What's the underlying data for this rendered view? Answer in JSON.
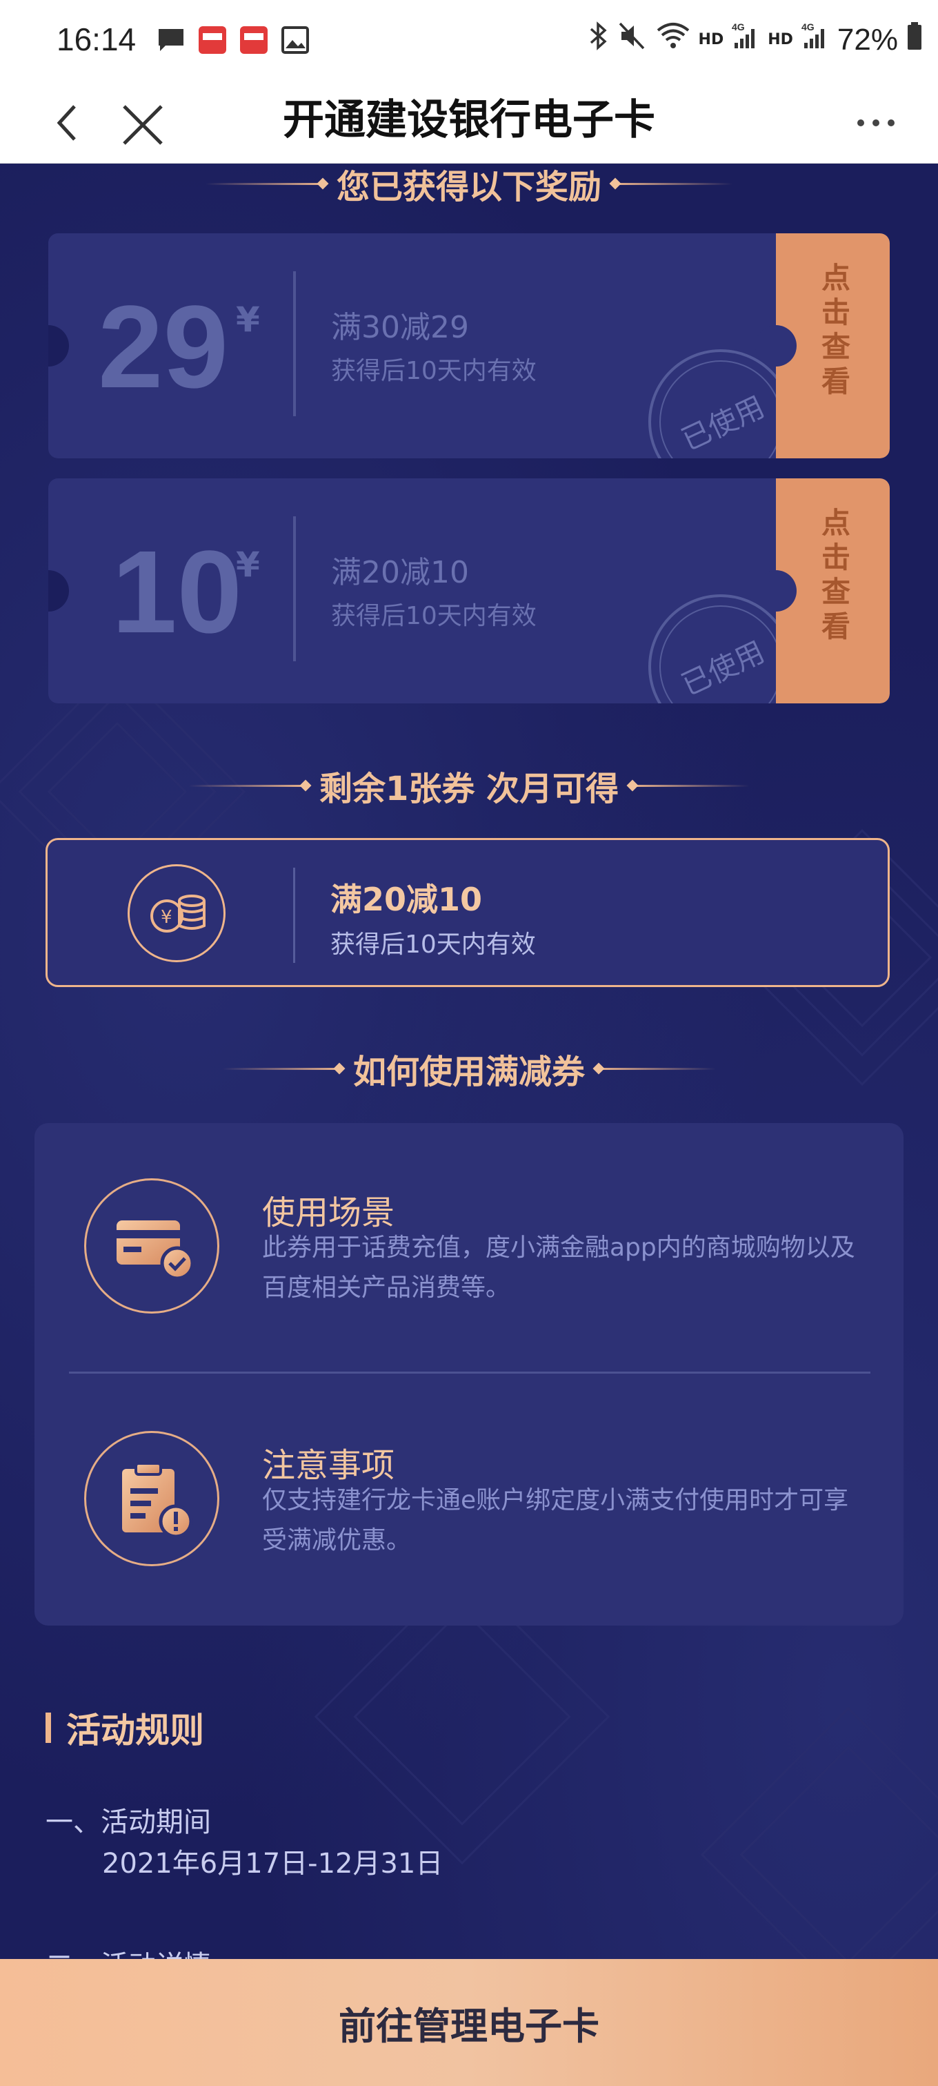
{
  "status_bar": {
    "time": "16:14",
    "battery": "72%",
    "network_labels": [
      "HD",
      "4G",
      "HD",
      "4G"
    ]
  },
  "nav": {
    "title": "开通建设银行电子卡"
  },
  "rewards": {
    "heading": "您已获得以下奖励",
    "coupons": [
      {
        "amount": "29",
        "currency": "¥",
        "title": "满30减29",
        "validity": "获得后10天内有效",
        "stamp": "已使用",
        "action": "点击查看"
      },
      {
        "amount": "10",
        "currency": "¥",
        "title": "满20减10",
        "validity": "获得后10天内有效",
        "stamp": "已使用",
        "action": "点击查看"
      }
    ]
  },
  "remaining": {
    "heading": "剩余1张券 次月可得",
    "title": "满20减10",
    "validity": "获得后10天内有效"
  },
  "howto": {
    "heading": "如何使用满减券",
    "items": [
      {
        "title": "使用场景",
        "desc": "此券用于话费充值，度小满金融app内的商城购物以及百度相关产品消费等。"
      },
      {
        "title": "注意事项",
        "desc": "仅支持建行龙卡通e账户绑定度小满支付使用时才可享受满减优惠。"
      }
    ]
  },
  "rules": {
    "title": "活动规则",
    "period_label": "一、活动期间",
    "period_value": "2021年6月17日-12月31日",
    "details_label": "二、活动详情"
  },
  "bottom_button": "前往管理电子卡",
  "colors": {
    "background": "#1b1e5c",
    "accent": "#efb58b",
    "tab": "#e1956a"
  }
}
